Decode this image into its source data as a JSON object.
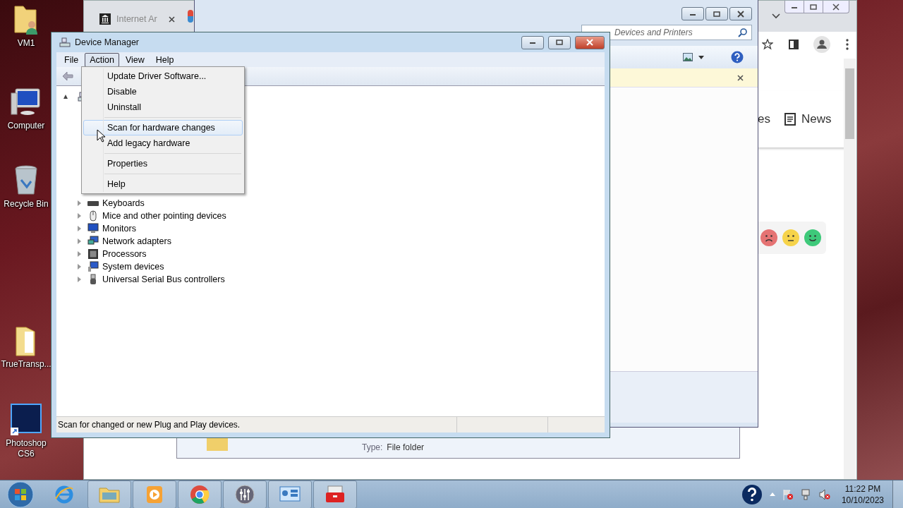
{
  "desktop": {
    "icons": [
      {
        "label": "VM1",
        "kind": "user-folder"
      },
      {
        "label": "Computer",
        "kind": "computer"
      },
      {
        "label": "Recycle Bin",
        "kind": "recycle-bin"
      },
      {
        "label": "TrueTransp...",
        "kind": "folder"
      },
      {
        "label": "Photoshop CS6",
        "kind": "photoshop"
      }
    ]
  },
  "browser": {
    "tabs": [
      {
        "label": "Internet Ar",
        "selected": false
      }
    ],
    "page_tabs": [
      {
        "label": "es",
        "kind": "text"
      },
      {
        "label": "News",
        "kind": "news"
      }
    ],
    "feedback_faces": [
      {
        "kind": "sad",
        "color": "#e57373"
      },
      {
        "kind": "neutral",
        "color": "#f6d34a"
      },
      {
        "kind": "happy",
        "color": "#3ec97a"
      }
    ]
  },
  "explorer": {
    "search": {
      "placeholder": "Devices and Printers"
    }
  },
  "details_pane": {
    "type_label": "Type:",
    "type_value": "File folder"
  },
  "device_manager": {
    "title": "Device Manager",
    "menu": [
      {
        "label": "File",
        "selected": false
      },
      {
        "label": "Action",
        "selected": true
      },
      {
        "label": "View",
        "selected": false
      },
      {
        "label": "Help",
        "selected": false
      }
    ],
    "action_menu": {
      "groups": [
        {
          "items": [
            {
              "label": "Update Driver Software...",
              "selected": false
            },
            {
              "label": "Disable",
              "selected": false
            },
            {
              "label": "Uninstall",
              "selected": false
            }
          ]
        },
        {
          "items": [
            {
              "label": "Scan for hardware changes",
              "selected": true
            },
            {
              "label": "Add legacy hardware",
              "selected": false
            }
          ]
        },
        {
          "items": [
            {
              "label": "Properties",
              "selected": false
            }
          ]
        },
        {
          "items": [
            {
              "label": "Help",
              "selected": false
            }
          ]
        }
      ]
    },
    "tree": {
      "root": {
        "expanded": true
      },
      "items": [
        {
          "label": "Keyboards",
          "kind": "keyboard",
          "expanded": false
        },
        {
          "label": "Mice and other pointing devices",
          "kind": "mouse",
          "expanded": false
        },
        {
          "label": "Monitors",
          "kind": "monitor",
          "expanded": false
        },
        {
          "label": "Network adapters",
          "kind": "network",
          "expanded": false
        },
        {
          "label": "Processors",
          "kind": "processor",
          "expanded": false
        },
        {
          "label": "System devices",
          "kind": "system",
          "expanded": false
        },
        {
          "label": "Universal Serial Bus controllers",
          "kind": "usb",
          "expanded": false
        }
      ]
    },
    "status": "Scan for changed or new Plug and Play devices."
  },
  "taskbar": {
    "apps": [
      {
        "kind": "ie"
      },
      {
        "kind": "explorer"
      },
      {
        "kind": "media"
      },
      {
        "kind": "chrome"
      },
      {
        "kind": "mixer"
      },
      {
        "kind": "control-panel"
      },
      {
        "kind": "toolbox"
      }
    ],
    "tray": [
      {
        "kind": "help"
      },
      {
        "kind": "arrow"
      },
      {
        "kind": "flag"
      },
      {
        "kind": "network"
      },
      {
        "kind": "volume-muted"
      }
    ],
    "clock": {
      "time": "11:22 PM",
      "date": "10/10/2023"
    }
  }
}
